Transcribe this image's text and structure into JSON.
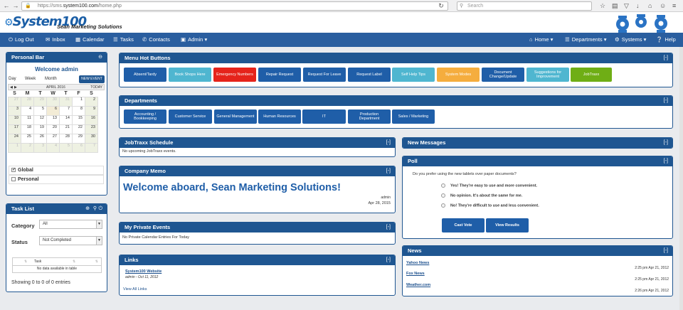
{
  "browser": {
    "url_prefix": "https://sms.",
    "url_domain": "system100.com",
    "url_path": "/home.php",
    "search_placeholder": "Search"
  },
  "brand": {
    "logo": "System100",
    "tagline": "Sean Marketing Solutions"
  },
  "nav": {
    "logout": "Log Out",
    "inbox": "Inbox",
    "calendar": "Calendar",
    "tasks": "Tasks",
    "contacts": "Contacts",
    "admin": "Admin",
    "home": "Home",
    "departments": "Departments",
    "systems": "Systems",
    "help": "Help"
  },
  "personal_bar": {
    "title": "Personal Bar",
    "welcome": "Welcome admin",
    "views": [
      "Day",
      "Week",
      "Month"
    ],
    "new_event": "NEW EVENT",
    "month": "APRIL 2016",
    "today": "TODAY",
    "dow": [
      "S",
      "M",
      "T",
      "W",
      "T",
      "F",
      "S"
    ],
    "weeks": [
      [
        "27",
        "28",
        "29",
        "30",
        "31",
        "1",
        "2"
      ],
      [
        "3",
        "4",
        "5",
        "6",
        "7",
        "8",
        "9"
      ],
      [
        "10",
        "11",
        "12",
        "13",
        "14",
        "15",
        "16"
      ],
      [
        "17",
        "18",
        "19",
        "20",
        "21",
        "22",
        "23"
      ],
      [
        "24",
        "25",
        "26",
        "27",
        "28",
        "29",
        "30"
      ],
      [
        "1",
        "2",
        "3",
        "4",
        "5",
        "6",
        "7"
      ]
    ],
    "filters": [
      {
        "label": "Global",
        "checked": true
      },
      {
        "label": "Personal",
        "checked": false
      }
    ]
  },
  "task_list": {
    "title": "Task List",
    "category_label": "Category",
    "category_value": "All",
    "status_label": "Status",
    "status_value": "Not Completed",
    "col_task": "Task",
    "empty": "No data available in table",
    "summary": "Showing 0 to 0 of 0 entries"
  },
  "hot_buttons": {
    "title": "Menu Hot Buttons",
    "toggle": "[-]",
    "items": [
      {
        "label": "Absent/Tardy",
        "color": "#1f5ea8"
      },
      {
        "label": "Book Shops Here",
        "color": "#4fb6d0"
      },
      {
        "label": "Emergency Numbers",
        "color": "#e5231b"
      },
      {
        "label": "Repair Request",
        "color": "#1f5ea8"
      },
      {
        "label": "Request For Leave",
        "color": "#1f5ea8"
      },
      {
        "label": "Request Label",
        "color": "#1f5ea8"
      },
      {
        "label": "Self Help Tips",
        "color": "#4fb6d0"
      },
      {
        "label": "System Modes",
        "color": "#f5ad3e"
      },
      {
        "label": "Document Change/Update",
        "color": "#1f5ea8"
      },
      {
        "label": "Suggestions for Improvement",
        "color": "#4fb6d0"
      },
      {
        "label": "JobTraxx",
        "color": "#6fae15"
      }
    ]
  },
  "departments": {
    "title": "Departments",
    "toggle": "[-]",
    "items": [
      "Accounting / Bookkeeping",
      "Customer Service",
      "General Management",
      "Human Resources",
      "IT",
      "Production Department",
      "Sales / Marketing"
    ]
  },
  "jobtraxx": {
    "title": "JobTraxx Schedule",
    "toggle": "[-]",
    "text": "No upcoming JobTraxx events."
  },
  "memo": {
    "title": "Company Memo",
    "toggle": "[-]",
    "headline": "Welcome aboard, Sean Marketing Solutions!",
    "author": "admin",
    "date": "Apr 28, 2015"
  },
  "private_events": {
    "title": "My Private Events",
    "toggle": "[-]",
    "text": "No Private Calendar Entries For Today"
  },
  "links": {
    "title": "Links",
    "toggle": "[-]",
    "link": "System100 Website",
    "meta": "admin - Oct 11, 2012",
    "all": "View All Links"
  },
  "messages": {
    "title": "New Messages",
    "toggle": "[-]"
  },
  "poll": {
    "title": "Poll",
    "toggle": "[-]",
    "question": "Do you prefer using the new tablets over paper documents?",
    "options": [
      "Yes! They're easy to use and more convenient.",
      "No opinion. It's about the same for me.",
      "No! They're difficult to use and less convenient."
    ],
    "cast": "Cast Vote",
    "results": "View Results"
  },
  "news": {
    "title": "News",
    "toggle": "[-]",
    "items": [
      {
        "label": "Yahoo News",
        "date": "2:25 pm Apr 21, 2012"
      },
      {
        "label": "Fox News",
        "date": "2:25 pm Apr 21, 2012"
      },
      {
        "label": "Weather.com",
        "date": "2:26 pm Apr 21, 2012"
      }
    ]
  },
  "colors": {
    "primary": "#1f5691",
    "nav": "#2a5e9f"
  }
}
